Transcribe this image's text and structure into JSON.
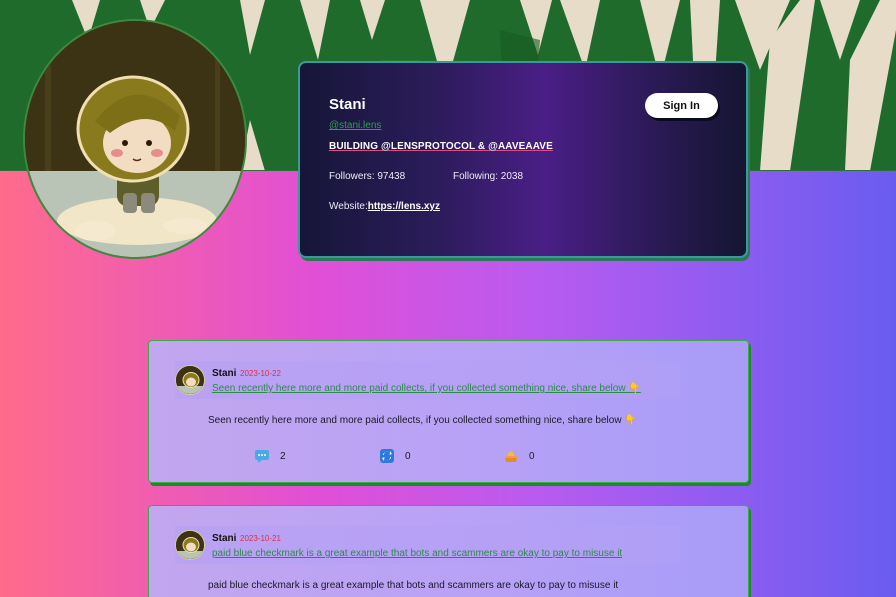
{
  "profile": {
    "name": "Stani",
    "handle": "@stani.lens",
    "bio": "BUILDING @LENSPROTOCOL & @AAVEAAVE",
    "followers_text": "Followers: 97438",
    "following_text": "Following: 2038",
    "website_label": "Website:",
    "website_url": "https://lens.xyz"
  },
  "header": {
    "signin_label": "Sign In"
  },
  "posts": [
    {
      "author": "Stani",
      "date": "2023-10-22",
      "link_text": "Seen recently here more and more paid collects, if you collected something nice, share below 👇",
      "body": "Seen recently here more and more paid collects, if you collected something nice, share below 👇",
      "comments": "2",
      "mirrors": "0",
      "collects": "0"
    },
    {
      "author": "Stani",
      "date": "2023-10-21",
      "link_text": "paid blue checkmark is a great example that bots and scammers are okay to pay to misuse it",
      "body": "paid blue checkmark is a great example that bots and scammers are okay to pay to misuse it"
    }
  ],
  "icons": {
    "comment": "comment-icon",
    "mirror": "mirror-icon",
    "collect": "collect-icon"
  },
  "colors": {
    "handle_green": "#2ea04a",
    "date_red": "#d8304a",
    "card_border": "#3a9a9a"
  }
}
